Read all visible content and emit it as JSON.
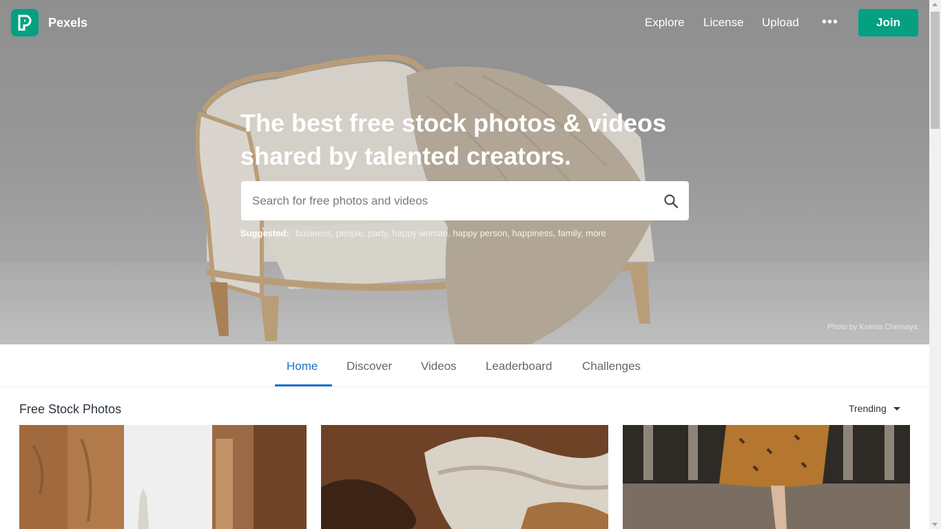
{
  "header": {
    "brand": "Pexels",
    "nav": [
      "Explore",
      "License",
      "Upload"
    ],
    "more_label": "•••",
    "join_label": "Join"
  },
  "hero": {
    "headline": "The best free stock photos & videos shared by talented creators.",
    "search_placeholder": "Search for free photos and videos",
    "suggested_label": "Suggested:",
    "suggested_tags": "business, people, party, happy woman, happy person, happiness, family, more",
    "credit": "Photo by Ksenia Chernaya"
  },
  "tabs": [
    "Home",
    "Discover",
    "Videos",
    "Leaderboard",
    "Challenges"
  ],
  "feed": {
    "title": "Free Stock Photos",
    "sort_label": "Trending"
  },
  "colors": {
    "brand": "#05a081",
    "tab_active": "#1a73c8"
  }
}
